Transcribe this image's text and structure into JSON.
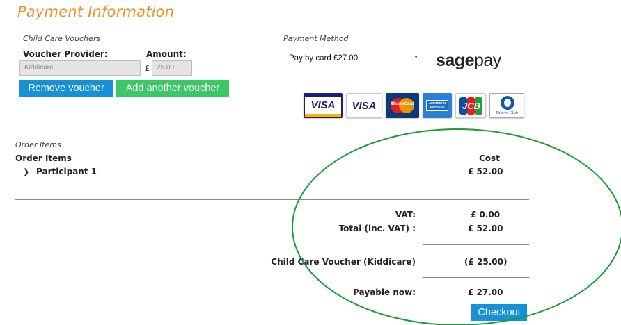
{
  "header": {
    "title": "Payment Information"
  },
  "vouchers": {
    "section_label": "Child Care Vouchers",
    "provider_label": "Voucher Provider:",
    "provider_value": "Kiddicare",
    "amount_label": "Amount:",
    "currency_symbol": "£",
    "amount_value": "25.00",
    "remove_button": "Remove voucher",
    "add_button": "Add another voucher"
  },
  "payment": {
    "section_label": "Payment Method",
    "method_value": "Pay by card £27.00",
    "provider_logo": {
      "part1": "sage",
      "part2": "pay"
    },
    "cards": [
      {
        "icon": "visa-card-icon",
        "text": "VISA"
      },
      {
        "icon": "visa-electron-card-icon",
        "text": "VISA"
      },
      {
        "icon": "mastercard-icon",
        "text": "MasterCard"
      },
      {
        "icon": "american-express-icon",
        "text": "AMERICAN EXPRESS"
      },
      {
        "icon": "jcb-card-icon",
        "text": "JCB"
      },
      {
        "icon": "diners-club-card-icon",
        "text": "Diners Club"
      }
    ]
  },
  "order": {
    "section_label": "Order Items",
    "heading": "Order Items",
    "cost_header": "Cost",
    "items": [
      {
        "label": "Participant 1",
        "cost": "£ 52.00"
      }
    ]
  },
  "totals": {
    "vat_label": "VAT:",
    "vat_value": "£ 0.00",
    "total_label": "Total (inc. VAT) :",
    "total_value": "£ 52.00",
    "voucher_label": "Child Care Voucher (Kiddicare)",
    "voucher_value": "(£ 25.00)",
    "payable_label": "Payable now:",
    "payable_value": "£ 27.00",
    "checkout_button": "Checkout"
  },
  "colors": {
    "title": "#f0902b",
    "blue_button": "#1791d5",
    "green_button": "#3cc766",
    "annotation_ellipse": "#1e9a3a"
  }
}
